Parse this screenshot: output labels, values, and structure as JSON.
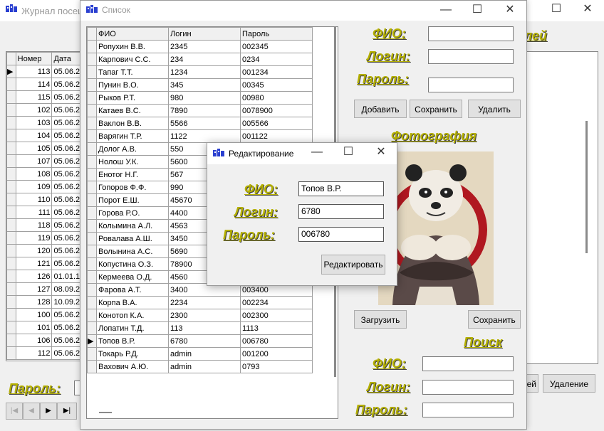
{
  "back_window": {
    "title": "Журнал посещ",
    "col_num": "Номер",
    "col_date": "Дата",
    "password_label": "Пароль:",
    "rows": [
      [
        "113",
        "05.06.2"
      ],
      [
        "114",
        "05.06.2"
      ],
      [
        "115",
        "05.06.2"
      ],
      [
        "102",
        "05.06.2"
      ],
      [
        "103",
        "05.06.2"
      ],
      [
        "104",
        "05.06.2"
      ],
      [
        "105",
        "05.06.2"
      ],
      [
        "107",
        "05.06.2"
      ],
      [
        "108",
        "05.06.2"
      ],
      [
        "109",
        "05.06.2"
      ],
      [
        "110",
        "05.06.2"
      ],
      [
        "111",
        "05.06.2"
      ],
      [
        "118",
        "05.06.2"
      ],
      [
        "119",
        "05.06.2"
      ],
      [
        "120",
        "05.06.2"
      ],
      [
        "121",
        "05.06.2"
      ],
      [
        "126",
        "01.01.1"
      ],
      [
        "127",
        "08.09.2"
      ],
      [
        "128",
        "10.09.2"
      ],
      [
        "100",
        "05.06.2"
      ],
      [
        "101",
        "05.06.2"
      ],
      [
        "106",
        "05.06.2"
      ],
      [
        "112",
        "05.06.2"
      ]
    ],
    "nav": [
      "|◀",
      "◀",
      "▶",
      "▶|"
    ]
  },
  "right_back_window": {
    "label_fragment": "лей",
    "btn_partial": "ей",
    "delete_button": "Удаление"
  },
  "list_window": {
    "title": "Список",
    "columns": [
      "ФИО",
      "Логин",
      "Пароль"
    ],
    "rows": [
      [
        "Ропухин В.В.",
        "2345",
        "002345"
      ],
      [
        "Карпович С.С.",
        "234",
        "0234"
      ],
      [
        "Тапаг Т.Т.",
        "1234",
        "001234"
      ],
      [
        "Пунин В.О.",
        "345",
        "00345"
      ],
      [
        "Рыков Р.Т.",
        "980",
        "00980"
      ],
      [
        "Катаев В.С.",
        "7890",
        "0078900"
      ],
      [
        "Ваклон В.В.",
        "5566",
        "005566"
      ],
      [
        "Варягин Т.Р.",
        "1122",
        "001122"
      ],
      [
        "Долог А.В.",
        "550",
        ""
      ],
      [
        "Нолош У.К.",
        "5600",
        ""
      ],
      [
        "Енотог Н.Г.",
        "567",
        ""
      ],
      [
        "Гопоров Ф.Ф.",
        "990",
        ""
      ],
      [
        "Порот Е.Ш.",
        "45670",
        ""
      ],
      [
        "Горова Р.О.",
        "4400",
        ""
      ],
      [
        "Колымина А.Л.",
        "4563",
        ""
      ],
      [
        "Ровалава А.Ш.",
        "3450",
        ""
      ],
      [
        "Волынина А.С.",
        "5690",
        ""
      ],
      [
        "Копустина О.З.",
        "78900",
        ""
      ],
      [
        "Кермеева О.Д.",
        "4560",
        ""
      ],
      [
        "Фарова А.Т.",
        "3400",
        "003400"
      ],
      [
        "Корпа В.А.",
        "2234",
        "002234"
      ],
      [
        "Конотоп К.А.",
        "2300",
        "002300"
      ],
      [
        "Лопатин Т.Д.",
        "113",
        "1113"
      ],
      [
        "Топов В.Р.",
        "6780",
        "006780"
      ],
      [
        "Токарь Р.Д.",
        "admin",
        "001200"
      ],
      [
        "Вахович А.Ю.",
        "admin",
        "0793"
      ]
    ],
    "current_row_index": 23,
    "fio_label": "ФИО:",
    "login_label": "Логин:",
    "password_label": "Пароль:",
    "add_button": "Добавить",
    "save_button": "Сохранить",
    "delete_button": "Удалить",
    "photo_label": "Фотография",
    "load_button": "Загрузить",
    "save_photo_button": "Сохранить",
    "search_label": "Поиск",
    "search_fio_label": "ФИО:",
    "search_login_label": "Логин:",
    "search_password_label": "Пароль:"
  },
  "edit_dialog": {
    "title": "Редактирование",
    "fio_label": "ФИО:",
    "login_label": "Логин:",
    "password_label": "Пароль:",
    "fio_value": "Топов В.Р.",
    "login_value": "6780",
    "password_value": "006780",
    "edit_button": "Редактировать"
  },
  "colors": {
    "label": "#b5b000",
    "selection": "#000000"
  }
}
